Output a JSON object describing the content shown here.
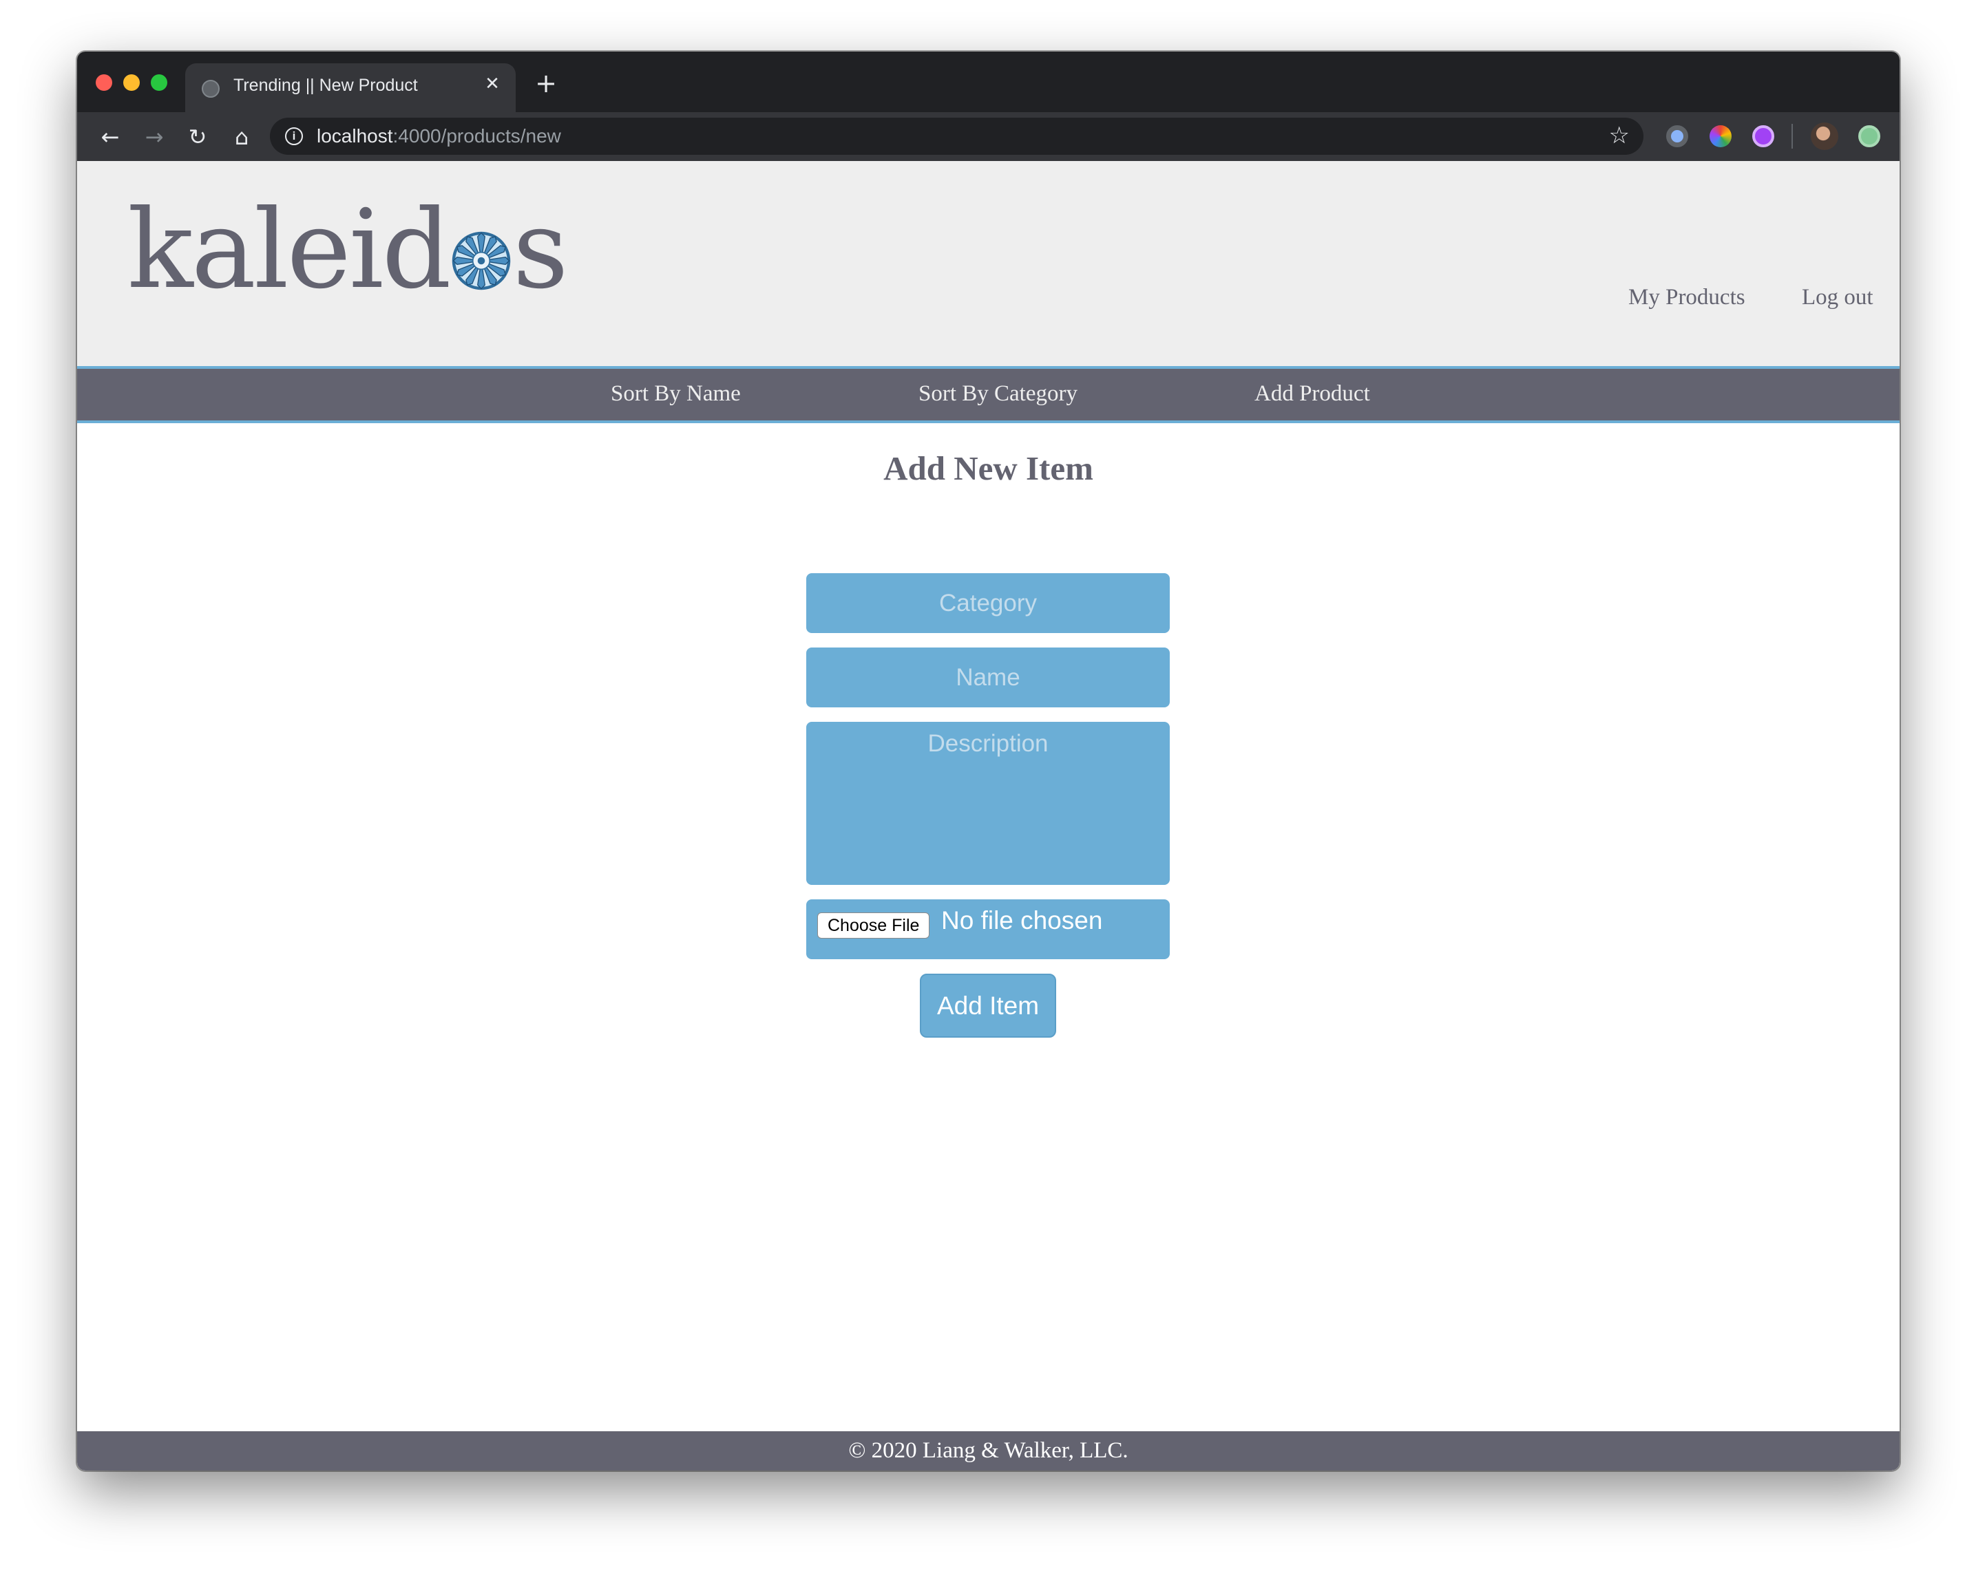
{
  "browser": {
    "tab_title": "Trending || New Product",
    "tab_close": "✕",
    "new_tab": "+",
    "url_host": "localhost",
    "url_rest": ":4000/products/new"
  },
  "site": {
    "logo_prefix": "kaleid",
    "logo_suffix": "s",
    "nav": {
      "my_products": "My Products",
      "log_out": "Log out"
    },
    "subnav": {
      "sort_by_name": "Sort By Name",
      "sort_by_category": "Sort By Category",
      "add_product": "Add Product"
    }
  },
  "form": {
    "title": "Add New Item",
    "category_placeholder": "Category",
    "name_placeholder": "Name",
    "description_placeholder": "Description",
    "file_button": "Choose File",
    "file_status": "No file chosen",
    "submit": "Add Item"
  },
  "footer": {
    "text": "© 2020 Liang & Walker, LLC."
  },
  "colors": {
    "accent": "#6baed6",
    "brand_gray": "#636370",
    "header_bg": "#eeeeee"
  }
}
